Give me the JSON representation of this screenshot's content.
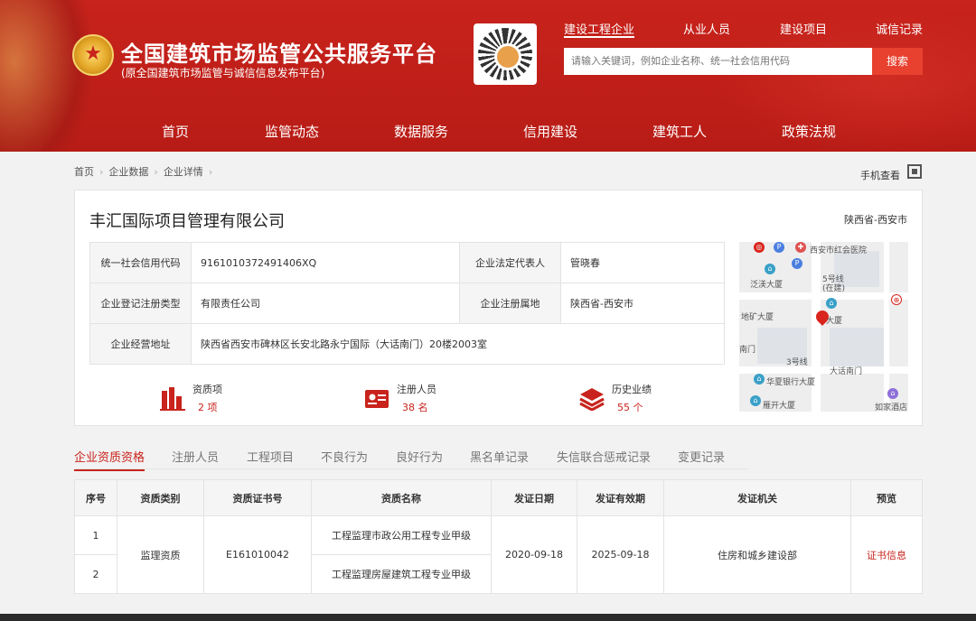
{
  "header": {
    "site_title": "全国建筑市场监管公共服务平台",
    "site_subtitle": "(原全国建筑市场监管与诚信信息发布平台)",
    "top_nav": [
      "建设工程企业",
      "从业人员",
      "建设项目",
      "诚信记录"
    ],
    "search_placeholder": "请输入关键词，例如企业名称、统一社会信用代码",
    "search_button": "搜索",
    "main_nav": [
      "首页",
      "监管动态",
      "数据服务",
      "信用建设",
      "建筑工人",
      "政策法规"
    ],
    "accent_color": "#c8231c"
  },
  "breadcrumb": [
    "首页",
    "企业数据",
    "企业详情"
  ],
  "mobile_view": "手机查看",
  "company": {
    "name": "丰汇国际项目管理有限公司",
    "region": "陕西省-西安市",
    "fields": {
      "credit_code_label": "统一社会信用代码",
      "credit_code": "9161010372491406XQ",
      "legal_rep_label": "企业法定代表人",
      "legal_rep": "管晓春",
      "reg_type_label": "企业登记注册类型",
      "reg_type": "有限责任公司",
      "reg_place_label": "企业注册属地",
      "reg_place": "陕西省-西安市",
      "address_label": "企业经营地址",
      "address": "陕西省西安市碑林区长安北路永宁国际（大话南门）20楼2003室"
    },
    "stats": [
      {
        "label": "资质项",
        "value": "2 项",
        "icon": "building-chart-icon"
      },
      {
        "label": "注册人员",
        "value": "38 名",
        "icon": "id-card-icon"
      },
      {
        "label": "历史业绩",
        "value": "55 个",
        "icon": "stack-layers-icon"
      }
    ]
  },
  "map": {
    "labels": [
      "西安市红会医院",
      "5号线",
      "(在建)",
      "泛渼大厦",
      "地矿大厦",
      "大厦",
      "3号线",
      "大话南门",
      "华夏银行大厦",
      "雁开大厦",
      "如家酒店",
      "南门"
    ]
  },
  "tabs": [
    "企业资质资格",
    "注册人员",
    "工程项目",
    "不良行为",
    "良好行为",
    "黑名单记录",
    "失信联合惩戒记录",
    "变更记录"
  ],
  "qualification_table": {
    "headers": [
      "序号",
      "资质类别",
      "资质证书号",
      "资质名称",
      "发证日期",
      "发证有效期",
      "发证机关",
      "预览"
    ],
    "rows": [
      {
        "no": "1",
        "name": "工程监理市政公用工程专业甲级"
      },
      {
        "no": "2",
        "name": "工程监理房屋建筑工程专业甲级"
      }
    ],
    "category": "监理资质",
    "cert_no": "E161010042",
    "issue_date": "2020-09-18",
    "valid_until": "2025-09-18",
    "authority": "住房和城乡建设部",
    "preview_link": "证书信息"
  }
}
